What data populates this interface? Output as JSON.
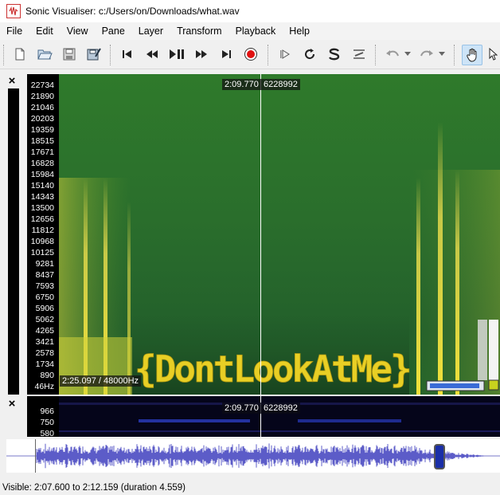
{
  "window": {
    "title": "Sonic Visualiser: c:/Users/on/Downloads/what.wav"
  },
  "menu": [
    "File",
    "Edit",
    "View",
    "Pane",
    "Layer",
    "Transform",
    "Playback",
    "Help"
  ],
  "toolbar": {
    "icons": [
      "new-file-icon",
      "open-folder-icon",
      "save-icon",
      "save-as-icon",
      "rewind-start-icon",
      "rewind-icon",
      "play-pause-icon",
      "fast-forward-icon",
      "ffwd-end-icon",
      "record-icon",
      "play-selection-icon",
      "loop-icon",
      "solo-icon",
      "scroll-icon",
      "undo-icon",
      "redo-icon",
      "navigate-hand-icon",
      "select-arrow-icon"
    ]
  },
  "spectrogram": {
    "frequency_labels": [
      "22734",
      "21890",
      "21046",
      "20203",
      "19359",
      "18515",
      "17671",
      "16828",
      "15984",
      "15140",
      "14343",
      "13500",
      "12656",
      "11812",
      "10968",
      "10125",
      "9281",
      "8437",
      "7593",
      "6750",
      "5906",
      "5062",
      "4265",
      "3421",
      "2578",
      "1734",
      "890",
      "46Hz"
    ],
    "cursor_time": "2:09.770",
    "cursor_frame": "6228992",
    "position_label": "2:25.097 / 48000Hz",
    "hidden_text": "{DontLookAtMe}",
    "colors": {
      "background": "#2a6b2a",
      "peak": "#e6d51f"
    }
  },
  "lower_pane": {
    "frequency_labels": [
      "966",
      "750",
      "580"
    ],
    "cursor_time": "2:09.770",
    "cursor_frame": "6228992"
  },
  "status": {
    "visible_text": "Visible: 2:07.600 to 2:12.159 (duration 4.559)"
  }
}
